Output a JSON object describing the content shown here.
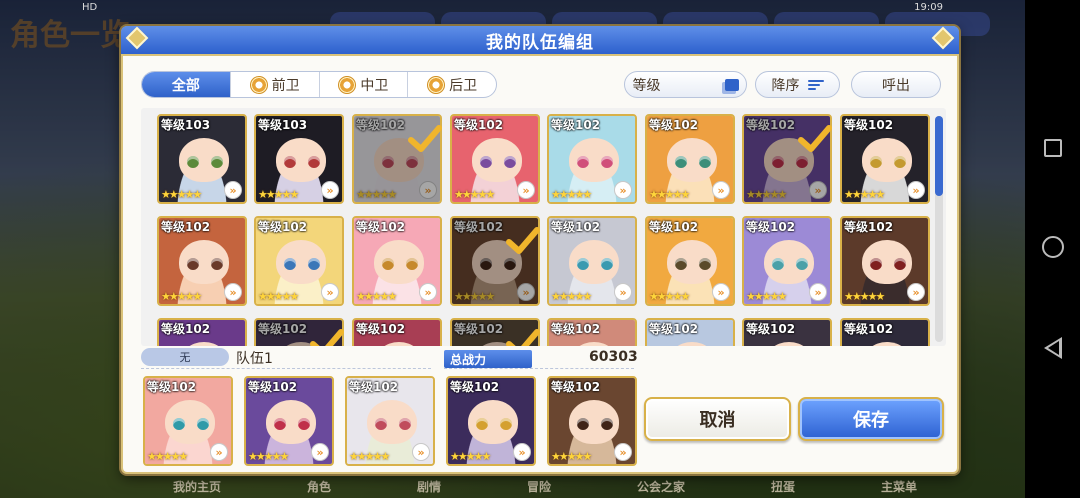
{
  "status_bar": {
    "left": "HD",
    "right": "19:09"
  },
  "background": {
    "title": "角色一览",
    "bottom_items": [
      "我的主页",
      "角色",
      "剧情",
      "冒险",
      "公会之家",
      "扭蛋",
      "主菜单"
    ]
  },
  "dialog": {
    "title": "我的队伍编组",
    "filters": [
      {
        "label": "全部",
        "active": true
      },
      {
        "label": "前卫",
        "active": false
      },
      {
        "label": "中卫",
        "active": false
      },
      {
        "label": "后卫",
        "active": false
      }
    ],
    "sort_label": "等级",
    "order_label": "降序",
    "call_label": "呼出"
  },
  "roster": [
    {
      "level": "等级103",
      "stars": "★★★★★",
      "selected": false,
      "bg": "#c7d6e8",
      "hair": "#2b2b36",
      "eye": "#5c8a3a"
    },
    {
      "level": "等级103",
      "stars": "★★★★★",
      "selected": false,
      "bg": "#d6d0e4",
      "hair": "#1e1c24",
      "eye": "#b23a3a"
    },
    {
      "level": "等级102",
      "stars": "★★★★★",
      "selected": true,
      "bg": "#e9e4ea",
      "hair": "#e8e6ec",
      "eye": "#c04c5c"
    },
    {
      "level": "等级102",
      "stars": "★★★★★",
      "selected": false,
      "bg": "#f3d1d6",
      "hair": "#e7636e",
      "eye": "#7a4c9e"
    },
    {
      "level": "等级102",
      "stars": "★★★★★",
      "selected": false,
      "bg": "#d6eef4",
      "hair": "#a9dbe8",
      "eye": "#d04f7a"
    },
    {
      "level": "等级102",
      "stars": "★★★★★",
      "selected": false,
      "bg": "#fbe0b8",
      "hair": "#eea041",
      "eye": "#3d8f7a"
    },
    {
      "level": "等级102",
      "stars": "★★★★★",
      "selected": true,
      "bg": "#cbb4dc",
      "hair": "#6a4a9c",
      "eye": "#c0304a"
    },
    {
      "level": "等级102",
      "stars": "★★★★★",
      "selected": false,
      "bg": "#d8d8d8",
      "hair": "#24222a",
      "eye": "#c49a30"
    },
    {
      "level": "等级102",
      "stars": "★★★★★",
      "selected": false,
      "bg": "#f7cfb2",
      "hair": "#c4643e",
      "eye": "#6a3a2a"
    },
    {
      "level": "等级102",
      "stars": "★★★★★",
      "selected": false,
      "bg": "#fbf0c8",
      "hair": "#f3d67a",
      "eye": "#3b77b8"
    },
    {
      "level": "等级102",
      "stars": "★★★★★",
      "selected": false,
      "bg": "#fbe2e6",
      "hair": "#f6a8b6",
      "eye": "#c6892c"
    },
    {
      "level": "等级102",
      "stars": "★★★★★",
      "selected": true,
      "bg": "#b89a80",
      "hair": "#6a4630",
      "eye": "#402418"
    },
    {
      "level": "等级102",
      "stars": "★★★★★",
      "selected": false,
      "bg": "#e4e6ec",
      "hair": "#c6c8d2",
      "eye": "#3a9ab0"
    },
    {
      "level": "等级102",
      "stars": "★★★★★",
      "selected": false,
      "bg": "#fbe2b6",
      "hair": "#f1a940",
      "eye": "#5a4a2a"
    },
    {
      "level": "等级102",
      "stars": "★★★★★",
      "selected": false,
      "bg": "#d6d0ec",
      "hair": "#9c8ad6",
      "eye": "#4aa0a8"
    },
    {
      "level": "等级102",
      "stars": "★★★★★",
      "selected": false,
      "bg": "#3a2c2c",
      "hair": "#5c3a2a",
      "eye": "#802020"
    },
    {
      "level": "等级102",
      "stars": "★★★★★",
      "selected": false,
      "bg": "#b67cc0",
      "hair": "#6a3a8a",
      "eye": "#c04a6a"
    },
    {
      "level": "等级102",
      "stars": "★★★★★",
      "selected": true,
      "bg": "#8a7a9a",
      "hair": "#4a3a5a",
      "eye": "#b04040"
    },
    {
      "level": "等级102",
      "stars": "★★★★★",
      "selected": false,
      "bg": "#e0a4b0",
      "hair": "#a83e54",
      "eye": "#5a2a3a"
    },
    {
      "level": "等级102",
      "stars": "★★★★★",
      "selected": true,
      "bg": "#a89a8a",
      "hair": "#5a4a3a",
      "eye": "#3a2a1a"
    },
    {
      "level": "等级102",
      "stars": "★★★★★",
      "selected": false,
      "bg": "#e8cfc8",
      "hair": "#d08a7a",
      "eye": "#6a3a2a"
    },
    {
      "level": "等级102",
      "stars": "★★★★★",
      "selected": false,
      "bg": "#dfe6f0",
      "hair": "#b8c8e0",
      "eye": "#6a8ac0"
    },
    {
      "level": "等级102",
      "stars": "★★★★★",
      "selected": false,
      "bg": "#d0c8d8",
      "hair": "#3a3240",
      "eye": "#4a4a6a"
    },
    {
      "level": "等级102",
      "stars": "★★★★★",
      "selected": false,
      "bg": "#f2d2c6",
      "hair": "#2e2a3a",
      "eye": "#a0645a"
    }
  ],
  "team": {
    "tag": "无",
    "name": "队伍1",
    "power_label": "总战力",
    "power_value": "60303",
    "members": [
      {
        "level": "等级102",
        "stars": "★★★★★",
        "bg": "#fbd6d0",
        "hair": "#f2a8a0",
        "eye": "#2f9aa8"
      },
      {
        "level": "等级102",
        "stars": "★★★★★",
        "bg": "#cbb4dc",
        "hair": "#6a4a9c",
        "eye": "#c0304a"
      },
      {
        "level": "等级102",
        "stars": "★★★★★",
        "bg": "#e9ecd8",
        "hair": "#e8e6ec",
        "eye": "#c04c5c"
      },
      {
        "level": "等级102",
        "stars": "★★★★★",
        "bg": "#c0b4d8",
        "hair": "#3c2c5c",
        "eye": "#d4a030"
      },
      {
        "level": "等级102",
        "stars": "★★★★★",
        "bg": "#d6b89a",
        "hair": "#6a4630",
        "eye": "#402418"
      }
    ]
  },
  "actions": {
    "cancel": "取消",
    "save": "保存"
  },
  "colors": {
    "accent": "#2f62c9",
    "gold": "#d8b149",
    "check": "#f0b52c"
  }
}
